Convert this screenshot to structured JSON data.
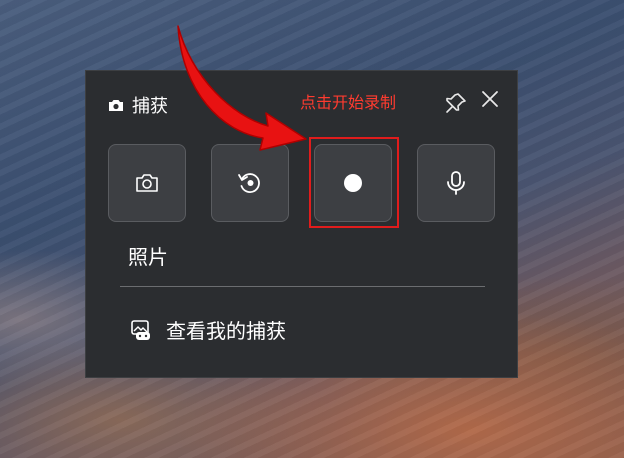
{
  "panel": {
    "title": "捕获",
    "hint": "点击开始录制",
    "section_label": "照片",
    "view_link": "查看我的捕获"
  },
  "tiles": [
    {
      "name": "screenshot",
      "icon": "camera-icon"
    },
    {
      "name": "recent",
      "icon": "rewind-icon"
    },
    {
      "name": "record",
      "icon": "record-dot-icon"
    },
    {
      "name": "microphone",
      "icon": "microphone-icon"
    }
  ],
  "colors": {
    "panel_bg": "#2b2d30",
    "tile_bg": "#3d3f43",
    "accent_red": "#e01c1c",
    "hint_red": "#ff3b2f"
  }
}
